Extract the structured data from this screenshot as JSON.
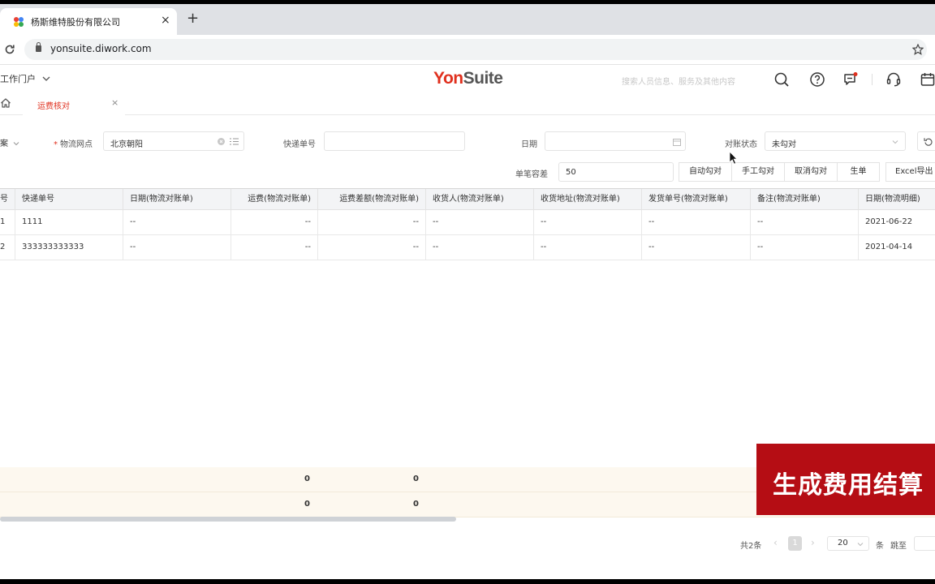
{
  "browser": {
    "tab_title": "杨斯维特股份有限公司",
    "tab_close": "×",
    "new_tab": "+",
    "url": "yonsuite.diwork.com"
  },
  "header": {
    "portal_label": "工作门户",
    "logo_part1": "Yon",
    "logo_part2": "Suite",
    "search_placeholder": "搜索人员信息、服务及其他内容",
    "icons": [
      "search-icon",
      "help-icon",
      "message-icon",
      "headset-icon",
      "calendar-icon"
    ]
  },
  "page_tabs": {
    "active_tab": "运费核对",
    "close": "×"
  },
  "filters": {
    "scheme_label": "案",
    "logistics_point_label": "物流网点",
    "logistics_point_value": "北京朝阳",
    "tracking_no_label": "快递单号",
    "tracking_no_value": "",
    "date_label": "日期",
    "date_value": "",
    "recon_status_label": "对账状态",
    "recon_status_value": "未勾对",
    "tolerance_label": "单笔容差",
    "tolerance_value": "50"
  },
  "actions": {
    "auto_match": "自动勾对",
    "manual_match": "手工勾对",
    "cancel_match": "取消勾对",
    "generate": "生单",
    "excel_export": "Excel导出"
  },
  "table": {
    "columns": [
      "号",
      "快递单号",
      "日期(物流对账单)",
      "运费(物流对账单)",
      "运费差额(物流对账单)",
      "收货人(物流对账单)",
      "收货地址(物流对账单)",
      "发货单号(物流对账单)",
      "备注(物流对账单)",
      "日期(物流明细)"
    ],
    "rows": [
      [
        "1",
        "1111",
        "--",
        "--",
        "--",
        "--",
        "--",
        "--",
        "--",
        "2021-06-22"
      ],
      [
        "2",
        "333333333333",
        "--",
        "--",
        "--",
        "--",
        "--",
        "--",
        "--",
        "2021-04-14"
      ]
    ],
    "summary": [
      {
        "freight": "0",
        "diff": "0"
      },
      {
        "freight": "0",
        "diff": "0"
      }
    ]
  },
  "pagination": {
    "total": "共2条",
    "current_page": "1",
    "page_size": "20",
    "per_page_unit": "条",
    "goto_label": "跳至"
  },
  "overlay": {
    "text": "生成费用结算"
  },
  "colors": {
    "brand_red": "#e0301e",
    "banner_red": "#b50d14"
  }
}
